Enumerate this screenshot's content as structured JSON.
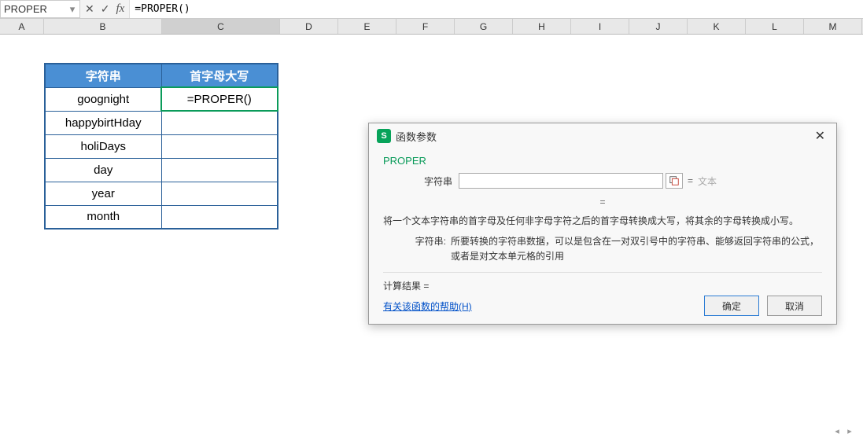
{
  "name_box": "PROPER",
  "formula_bar": "=PROPER()",
  "columns": [
    "A",
    "B",
    "C",
    "D",
    "E",
    "F",
    "G",
    "H",
    "I",
    "J",
    "K",
    "L",
    "M"
  ],
  "active_column_idx": 2,
  "table": {
    "headers": [
      "字符串",
      "首字母大写"
    ],
    "rows": [
      {
        "str": "goognight",
        "out": "=PROPER()"
      },
      {
        "str": "happybirtHday",
        "out": ""
      },
      {
        "str": "holiDays",
        "out": ""
      },
      {
        "str": "day",
        "out": ""
      },
      {
        "str": "year",
        "out": ""
      },
      {
        "str": "month",
        "out": ""
      }
    ],
    "active_row": 0
  },
  "dialog": {
    "title": "函数参数",
    "fn_name": "PROPER",
    "arg_label": "字符串",
    "arg_value": "",
    "eq_hint": "文本",
    "eq_center": "=",
    "description": "将一个文本字符串的首字母及任何非字母字符之后的首字母转换成大写，将其余的字母转换成小写。",
    "arg_desc_label": "字符串:",
    "arg_desc_text": "所要转换的字符串数据，可以是包含在一对双引号中的字符串、能够返回字符串的公式，或者是对文本单元格的引用",
    "result_label": "计算结果 =",
    "result_value": "",
    "help_link": "有关该函数的帮助(H)",
    "ok": "确定",
    "cancel": "取消"
  }
}
